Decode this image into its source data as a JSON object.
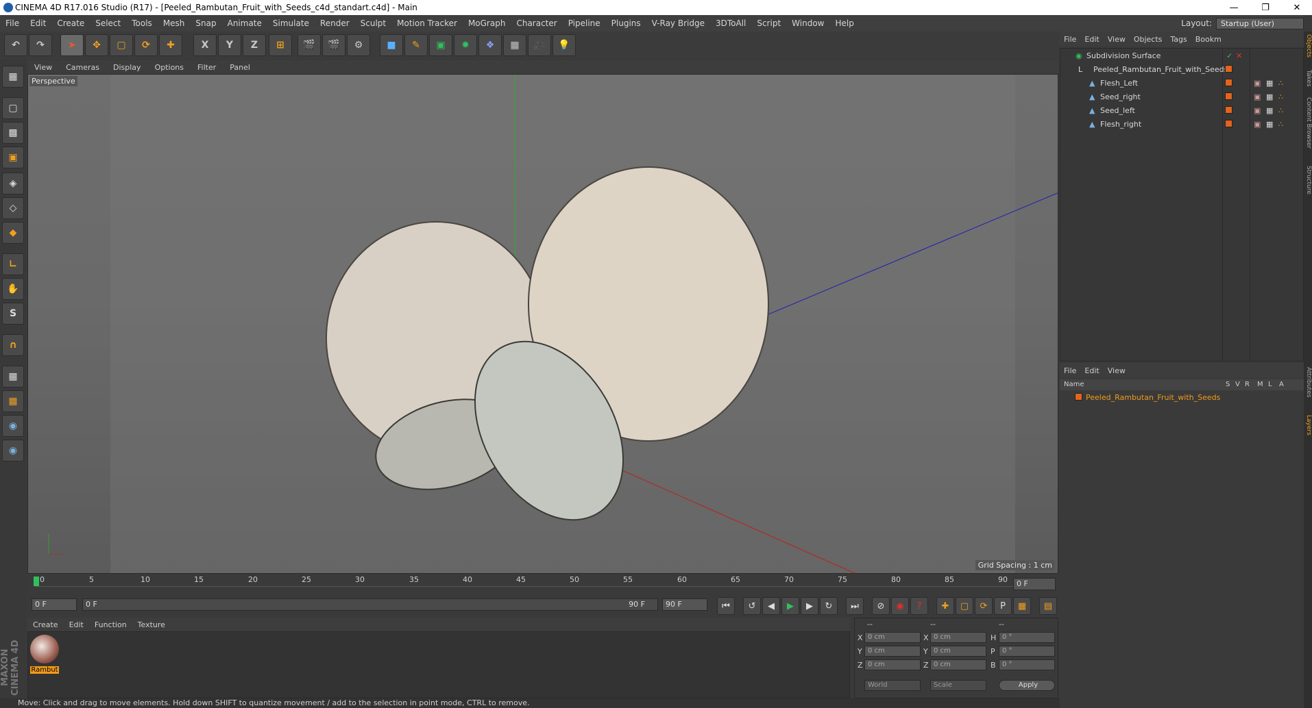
{
  "window": {
    "title": "CINEMA 4D R17.016 Studio (R17) - [Peeled_Rambutan_Fruit_with_Seeds_c4d_standart.c4d] - Main"
  },
  "menu": [
    "File",
    "Edit",
    "Create",
    "Select",
    "Tools",
    "Mesh",
    "Snap",
    "Animate",
    "Simulate",
    "Render",
    "Sculpt",
    "Motion Tracker",
    "MoGraph",
    "Character",
    "Pipeline",
    "Plugins",
    "V-Ray Bridge",
    "3DToAll",
    "Script",
    "Window",
    "Help"
  ],
  "layout": {
    "label": "Layout:",
    "value": "Startup (User)"
  },
  "toolbar": {
    "axis_x": "X",
    "axis_y": "Y",
    "axis_z": "Z"
  },
  "viewport": {
    "menu": [
      "View",
      "Cameras",
      "Display",
      "Options",
      "Filter",
      "Panel"
    ],
    "name": "Perspective",
    "grid_spacing": "Grid Spacing : 1 cm"
  },
  "timeline": {
    "ticks": [
      "0",
      "5",
      "10",
      "15",
      "20",
      "25",
      "30",
      "35",
      "40",
      "45",
      "50",
      "55",
      "60",
      "65",
      "70",
      "75",
      "80",
      "85",
      "90"
    ],
    "end_frame": "0 F"
  },
  "transport": {
    "start": "0 F",
    "range_start": "0 F",
    "range_end": "90 F",
    "end": "90 F"
  },
  "material": {
    "menu": [
      "Create",
      "Edit",
      "Function",
      "Texture"
    ],
    "name": "Rambut"
  },
  "coords": {
    "labels": {
      "x": "X",
      "y": "Y",
      "z": "Z",
      "h": "H",
      "p": "P",
      "b": "B"
    },
    "pos": [
      "0 cm",
      "0 cm",
      "0 cm"
    ],
    "size": [
      "0 cm",
      "0 cm",
      "0 cm"
    ],
    "rot": [
      "0 °",
      "0 °",
      "0 °"
    ],
    "mode1": "World",
    "mode2": "Scale",
    "apply": "Apply",
    "hdr": [
      "--",
      "--",
      "--"
    ]
  },
  "status": "Move: Click and drag to move elements. Hold down SHIFT to quantize movement / add to the selection in point mode, CTRL to remove.",
  "objects": {
    "menu": [
      "File",
      "Edit",
      "View",
      "Objects",
      "Tags",
      "Bookm"
    ],
    "items": [
      "Subdivision Surface",
      "Peeled_Rambutan_Fruit_with_Seeds",
      "Flesh_Left",
      "Seed_right",
      "Seed_left",
      "Flesh_right"
    ]
  },
  "layers": {
    "menu": [
      "File",
      "Edit",
      "View"
    ],
    "header": {
      "name": "Name",
      "cols": [
        "S",
        "V",
        "R",
        "M",
        "L",
        "A"
      ]
    },
    "item": "Peeled_Rambutan_Fruit_with_Seeds"
  },
  "side_tabs": [
    "Objects",
    "Takes",
    "Content Browser",
    "Structure",
    "Attributes",
    "Layers"
  ],
  "brand": "MAXON CINEMA 4D"
}
